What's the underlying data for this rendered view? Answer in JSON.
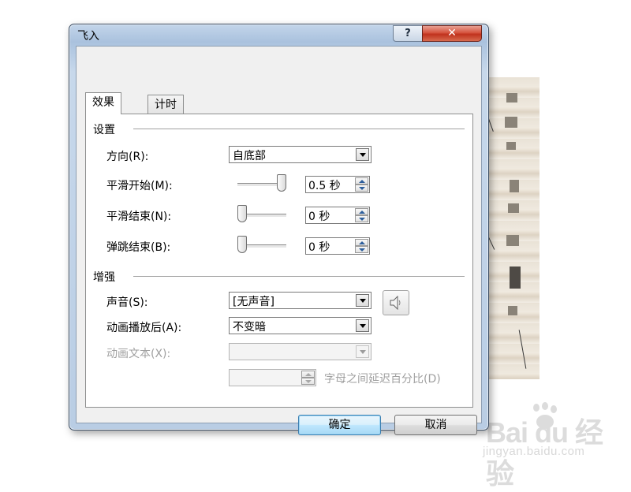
{
  "window": {
    "title": "飞入",
    "help_label": "?",
    "close_label": "✕"
  },
  "tabs": [
    {
      "label": "效果"
    },
    {
      "label": "计时"
    }
  ],
  "settings": {
    "heading": "设置",
    "direction": {
      "label": "方向(R):",
      "value": "自底部"
    },
    "smooth_start": {
      "label": "平滑开始(M):",
      "value": "0.5 秒",
      "slider_fraction": 1.0
    },
    "smooth_end": {
      "label": "平滑结束(N):",
      "value": "0 秒",
      "slider_fraction": 0.0
    },
    "bounce_end": {
      "label": "弹跳结束(B):",
      "value": "0 秒",
      "slider_fraction": 0.0
    }
  },
  "enhancements": {
    "heading": "增强",
    "sound": {
      "label": "声音(S):",
      "value": "[无声音]",
      "speaker_icon": "speaker-icon"
    },
    "after_animation": {
      "label": "动画播放后(A):",
      "value": "不变暗"
    },
    "animate_text": {
      "label": "动画文本(X):",
      "value": ""
    },
    "letter_delay": {
      "value": "",
      "label": "字母之间延迟百分比(D)"
    }
  },
  "buttons": {
    "ok": "确定",
    "cancel": "取消"
  },
  "watermark": {
    "logo": "Bai du 经验",
    "url": "jingyan.baidu.com"
  }
}
